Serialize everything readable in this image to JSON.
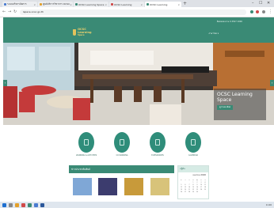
{
  "browser": {
    "tabs": [
      {
        "label": "ระบบบริหารจัดการ",
        "color": "#4a7bd0"
      },
      {
        "label": "ศูนย์บริการวิชาการ OCSC",
        "color": "#e3a02b"
      },
      {
        "label": "OCSC Learning Space",
        "color": "#3a8a75"
      },
      {
        "label": "OCSC Learning",
        "color": "#d04a4a"
      },
      {
        "label": "OCSC Learning",
        "color": "#3a8a75"
      }
    ],
    "new_tab": "+",
    "url": "lspace.ocsc.go.th",
    "window_controls": [
      "–",
      "☐",
      "✕"
    ]
  },
  "site": {
    "logo_line1": "OCSC Learning",
    "logo_line2": "Space",
    "top_info": "ติดต่อสอบถาม 0 2547 1000",
    "lang": "ภาษาไทย ▾",
    "hero_title": "OCSC Learning Space",
    "hero_button": "ดูรายละเอียด",
    "prev": "‹",
    "next": "›"
  },
  "services": [
    {
      "label": "LEARNING & ACTIVITIES"
    },
    {
      "label": "CO-WORKING"
    },
    {
      "label": "E-RESOURCES"
    },
    {
      "label": "CALENDAR"
    }
  ],
  "news": {
    "heading": "ข่าวประชาสัมพันธ์",
    "cards": [
      {
        "color": "#7fa7d6"
      },
      {
        "color": "#3c3c6e"
      },
      {
        "color": "#c89a3a"
      },
      {
        "color": "#d8c37a"
      }
    ]
  },
  "calendar": {
    "heading": "ปฏิทิน",
    "title": "เมษายน 2020",
    "days": [
      "อา",
      "จ",
      "อ",
      "พ",
      "พฤ",
      "ศ",
      "ส",
      "",
      "",
      "",
      "1",
      "2",
      "3",
      "4",
      "5",
      "6",
      "7",
      "8",
      "9",
      "10",
      "11",
      "12",
      "13",
      "14",
      "15",
      "16",
      "17",
      "18",
      "19",
      "20",
      "21",
      "22",
      "23",
      "24",
      "25",
      "26",
      "27",
      "28",
      "29",
      "30"
    ]
  },
  "taskbar": {
    "tray": "11:26"
  }
}
